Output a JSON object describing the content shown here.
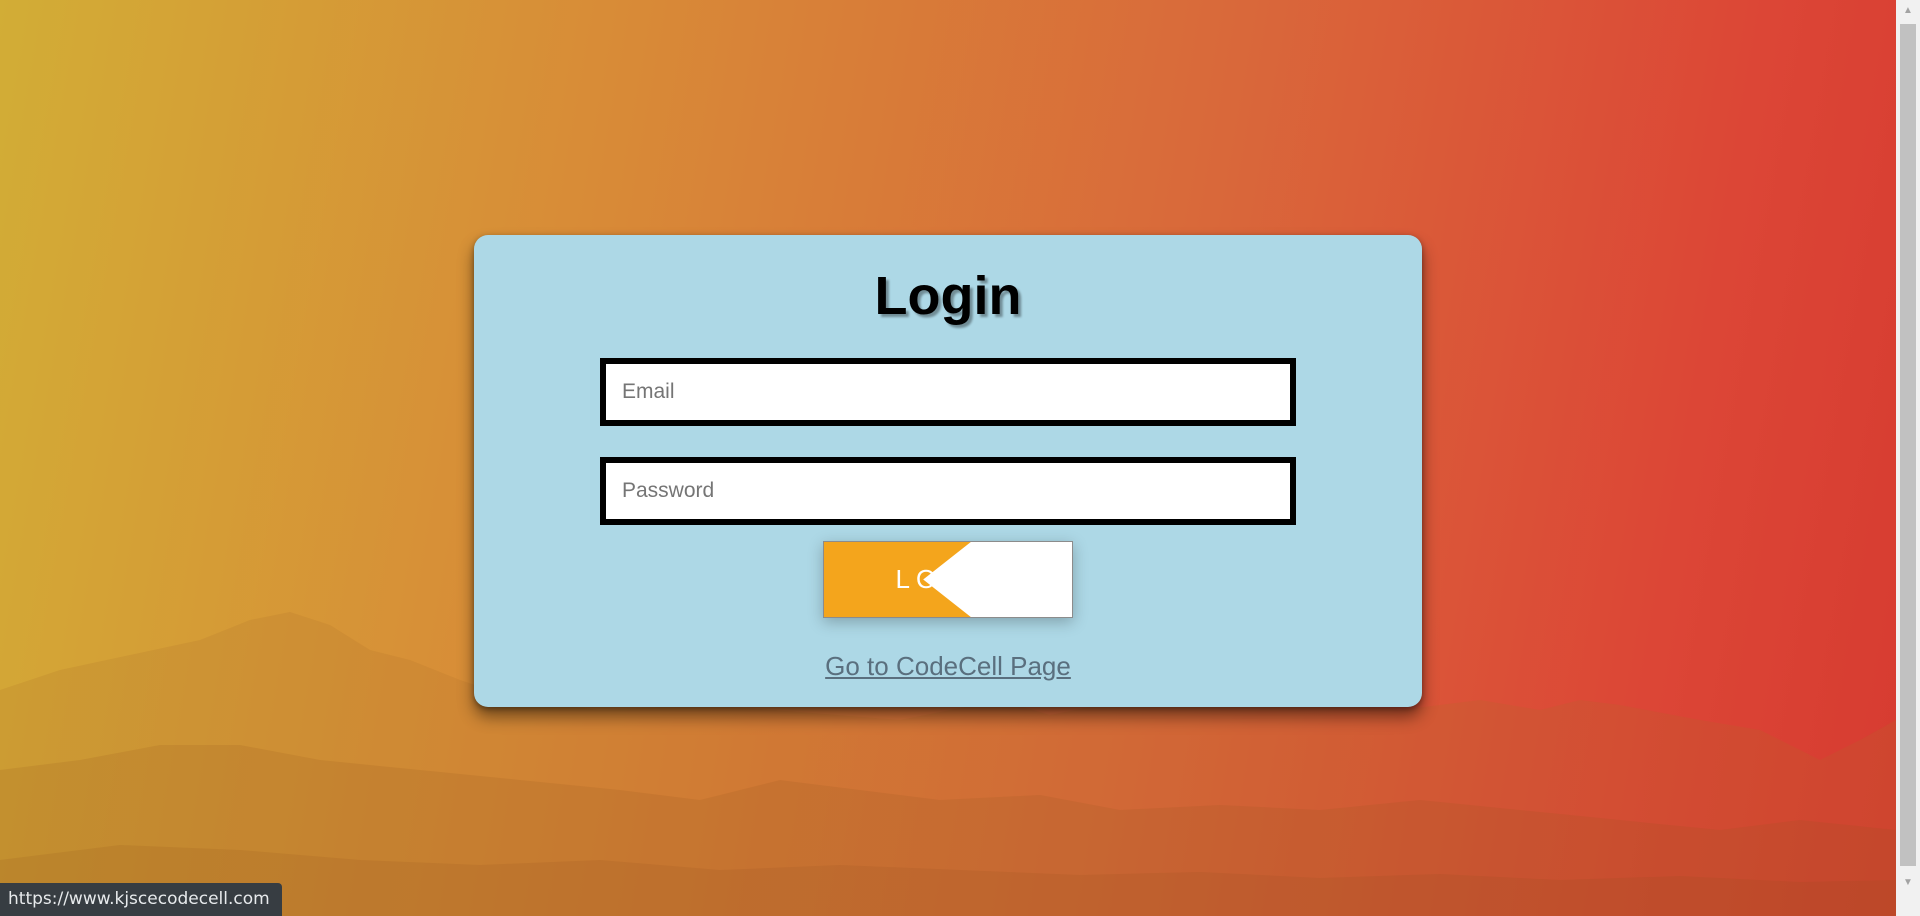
{
  "page": {
    "background_colors": [
      "#d2ad36",
      "#d88b37",
      "#d9683a",
      "#dc4636"
    ]
  },
  "login_card": {
    "title": "Login",
    "background_color": "#add8e6",
    "email": {
      "placeholder": "Email",
      "value": ""
    },
    "password": {
      "placeholder": "Password",
      "value": ""
    },
    "login_button": {
      "label": "LOGIN",
      "accent_color": "#f4a51c"
    },
    "codecell_link": {
      "label": "Go to CodeCell Page"
    }
  },
  "status_bar": {
    "url": "https://www.kjscecodecell.com"
  },
  "scrollbar": {
    "up_icon": "arrow-up-icon",
    "down_icon": "arrow-down-icon"
  }
}
